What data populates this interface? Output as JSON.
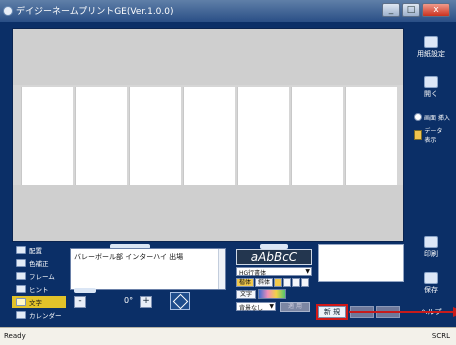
{
  "window": {
    "title": "デイジーネームプリントGE(Ver.1.0.0)"
  },
  "window_controls": {
    "minimize": "_",
    "maximize": "□",
    "close": "x"
  },
  "right_panel": {
    "paper_settings": "用紙設定",
    "open": "開く",
    "insert_image": "画面\n挿入",
    "data_display": "データ\n表示",
    "print": "印刷",
    "save": "保存",
    "help": "ヘルプ"
  },
  "sidebar": {
    "items": [
      {
        "label": "配置"
      },
      {
        "label": "色補正"
      },
      {
        "label": "フレーム"
      },
      {
        "label": "ヒント"
      },
      {
        "label": "文字"
      },
      {
        "label": "カレンダー"
      }
    ]
  },
  "text_panel": {
    "content": "バレーボール部 インターハイ 出場",
    "angle_value": "0°",
    "minus": "-",
    "plus": "+"
  },
  "font_panel": {
    "preview_text": "aAbBcC",
    "font_name": "HG行書体",
    "style_buttons": [
      "楷体",
      "斜体"
    ],
    "text_label": "文字",
    "background_option": "背景なし",
    "apply_label": "適 用"
  },
  "actions": {
    "new_label": "新 規"
  },
  "status": {
    "left": "Ready",
    "right": "SCRL"
  }
}
